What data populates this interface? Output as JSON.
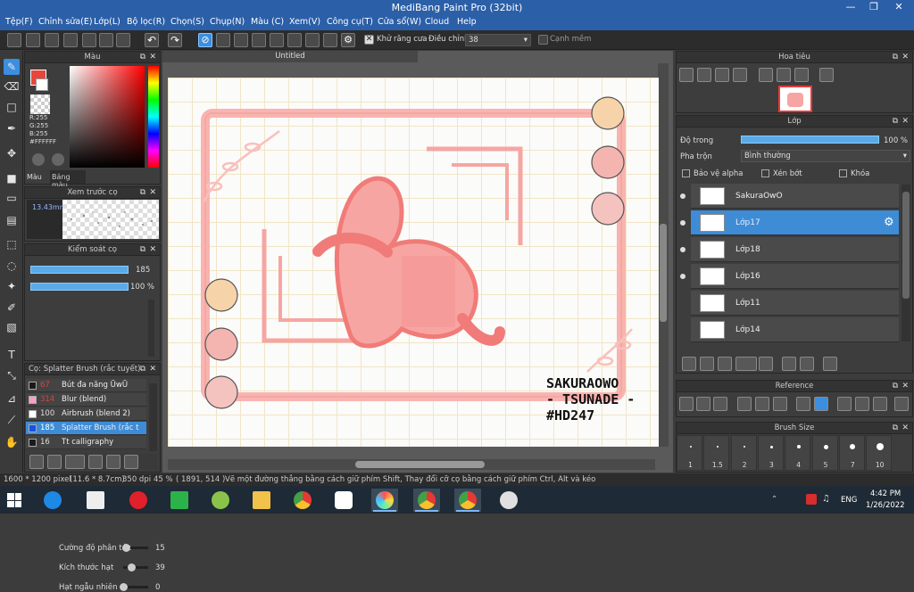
{
  "window": {
    "title": "MediBang Paint Pro (32bit)",
    "min": "—",
    "max": "❐",
    "close": "✕"
  },
  "menu": [
    "Tệp(F)",
    "Chỉnh sửa(E)",
    "Lớp(L)",
    "Bộ lọc(R)",
    "Chọn(S)",
    "Chụp(N)",
    "Màu (C)",
    "Xem(V)",
    "Công cụ(T)",
    "Cửa sổ(W)",
    "Cloud",
    "Help"
  ],
  "toolbar": {
    "antialias_label": "Khử răng cưa",
    "correction_label": "Điều chỉnh",
    "correction_value": "38",
    "soft_edge_label": "Cạnh mềm"
  },
  "color_panel": {
    "title": "Màu",
    "rgb": [
      "R:255",
      "G:255",
      "B:255",
      "#FFFFFF"
    ],
    "tab_color": "Màu",
    "tab_palette": "Bảng màu",
    "primary": "#e8453b",
    "secondary": "#ffffff"
  },
  "preview_panel": {
    "title": "Xem trước cọ",
    "size": "13.43mm"
  },
  "brush_control": {
    "title": "Kiểm soát cọ",
    "size_value": "185",
    "size_fraction": 1.0,
    "opacity_value": "100 %",
    "opacity_fraction": 1.0,
    "sliders": [
      {
        "label": "Cường độ phân tán",
        "value": "15",
        "fraction": 0.15
      },
      {
        "label": "Kích thước hạt",
        "value": "39",
        "fraction": 0.39
      },
      {
        "label": "Hạt ngẫu nhiên",
        "value": "0",
        "fraction": 0.0
      }
    ]
  },
  "brush_list": {
    "title": "Cọ: Splatter Brush (rắc tuyết)",
    "items": [
      {
        "size": "67",
        "name": "Bút đa năng ŪwŪ",
        "color": "#1a1a1a",
        "size_color": "#e04040"
      },
      {
        "size": "314",
        "name": "Blur (blend)",
        "color": "#f6a0c8",
        "size_color": "#e04040"
      },
      {
        "size": "100",
        "name": "Airbrush (blend 2)",
        "color": "#ffffff",
        "size_color": "#dddddd"
      },
      {
        "size": "185",
        "name": "Splatter Brush (rắc t",
        "color": "#1d4fe0",
        "size_color": "#ffffff",
        "selected": true
      },
      {
        "size": "16",
        "name": "Tt calligraphy",
        "color": "#1a1a1a",
        "size_color": "#dddddd"
      }
    ]
  },
  "document": {
    "tab": "Untitled",
    "artwork_text": [
      "SAKURAOWO",
      "- TSUNADE -",
      "#HD247"
    ]
  },
  "navigator": {
    "title": "Hoa tiêu"
  },
  "layers": {
    "title": "Lớp",
    "opacity_label": "Độ trong",
    "opacity_value": "100 %",
    "opacity_fraction": 1.0,
    "blend_label": "Pha trộn",
    "blend_value": "Bình thường",
    "protect_alpha": "Bảo vệ alpha",
    "clipping": "Xén bớt",
    "lock": "Khóa",
    "items": [
      {
        "name": "SakuraOwO",
        "visible": true,
        "selected": false
      },
      {
        "name": "Lớp17",
        "visible": true,
        "selected": true
      },
      {
        "name": "Lớp18",
        "visible": true,
        "selected": false
      },
      {
        "name": "Lớp16",
        "visible": true,
        "selected": false
      },
      {
        "name": "Lớp11",
        "visible": false,
        "selected": false
      },
      {
        "name": "Lớp14",
        "visible": false,
        "selected": false
      }
    ]
  },
  "reference": {
    "title": "Reference"
  },
  "brush_size": {
    "title": "Brush Size",
    "sizes": [
      "1",
      "1.5",
      "2",
      "3",
      "4",
      "5",
      "7",
      "10"
    ]
  },
  "status": {
    "dimensions": "1600 * 1200 pixel",
    "physical": "(11.6 * 8.7cm)",
    "dpi": "350 dpi",
    "zoom": "45 %",
    "coords": "( 1891, 514 )",
    "hint": "Vẽ một đường thẳng bằng cách giữ phím Shift, Thay đổi cỡ cọ bằng cách giữ phím Ctrl, Alt và kéo"
  },
  "taskbar": {
    "language": "ENG",
    "time": "4:42 PM",
    "date": "1/26/2022"
  }
}
